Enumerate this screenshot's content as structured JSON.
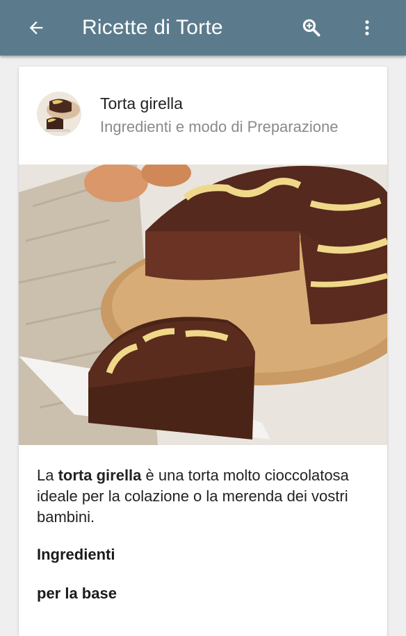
{
  "app_bar": {
    "title": "Ricette di Torte",
    "back_icon": "arrow-back-icon",
    "search_icon": "search-icon",
    "more_icon": "more-vert-icon",
    "color": "#5b7b8c"
  },
  "card": {
    "title": "Torta girella",
    "subtitle": "Ingredienti e modo di Preparazione",
    "intro": {
      "before": "La ",
      "bold": "torta girella",
      "after": " è una torta molto cioccolatosa ideale per la colazione o la merenda dei vostri bambini."
    },
    "heading_ingredients": "Ingredienti",
    "heading_base": "per la base"
  }
}
